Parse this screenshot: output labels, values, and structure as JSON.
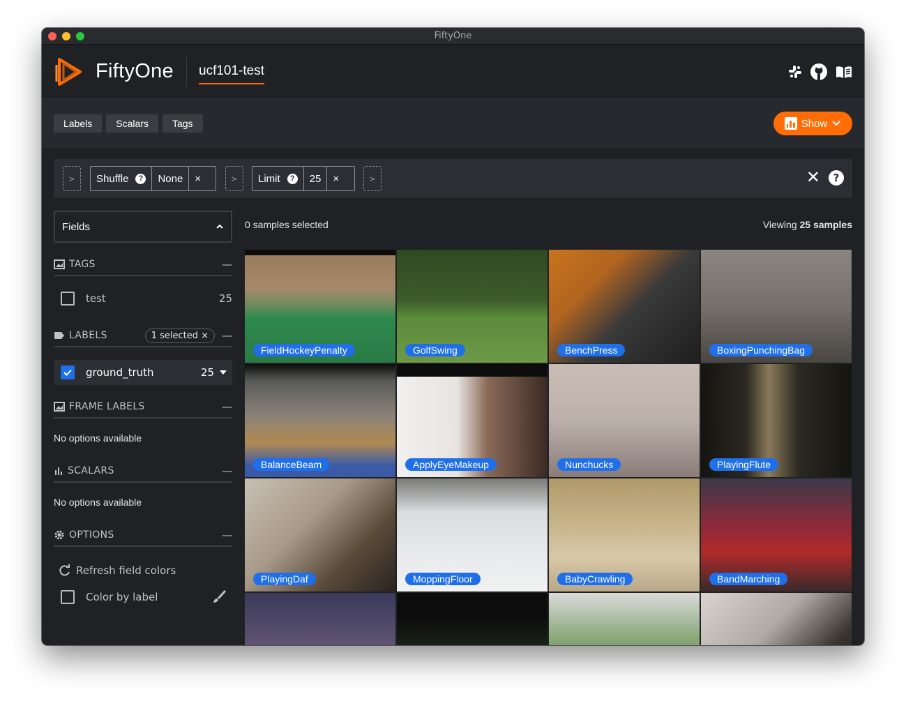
{
  "window": {
    "title": "FiftyOne"
  },
  "header": {
    "app_name": "FiftyOne",
    "dataset": "ucf101-test",
    "icons": [
      "slack-icon",
      "github-icon",
      "docs-icon"
    ]
  },
  "toolbar": {
    "tabs": [
      "Labels",
      "Scalars",
      "Tags"
    ],
    "show_label": "Show"
  },
  "stages": {
    "shuffle": {
      "name": "Shuffle",
      "value": "None"
    },
    "limit": {
      "name": "Limit",
      "value": "25"
    },
    "add_glyph": ">"
  },
  "sidebar": {
    "fields_title": "Fields",
    "tags": {
      "title": "TAGS",
      "items": [
        {
          "label": "test",
          "count": "25"
        }
      ]
    },
    "labels": {
      "title": "LABELS",
      "badge": "1 selected",
      "items": [
        {
          "label": "ground_truth",
          "count": "25"
        }
      ]
    },
    "frame_labels": {
      "title": "FRAME LABELS",
      "empty": "No options available"
    },
    "scalars": {
      "title": "SCALARS",
      "empty": "No options available"
    },
    "options": {
      "title": "OPTIONS",
      "refresh": "Refresh field colors",
      "color_by_label": "Color by label"
    }
  },
  "main": {
    "selected_text": "0 samples selected",
    "viewing_prefix": "Viewing",
    "viewing_count": "25 samples",
    "samples": [
      {
        "label": "FieldHockeyPenalty"
      },
      {
        "label": "GolfSwing"
      },
      {
        "label": "BenchPress"
      },
      {
        "label": "BoxingPunchingBag"
      },
      {
        "label": "BalanceBeam"
      },
      {
        "label": "ApplyEyeMakeup"
      },
      {
        "label": "Nunchucks"
      },
      {
        "label": "PlayingFlute"
      },
      {
        "label": "PlayingDaf"
      },
      {
        "label": "MoppingFloor"
      },
      {
        "label": "BabyCrawling"
      },
      {
        "label": "BandMarching"
      }
    ]
  },
  "colors": {
    "accent": "#ff6d04",
    "label_blue": "#1f6feb",
    "background": "#1f2124"
  }
}
